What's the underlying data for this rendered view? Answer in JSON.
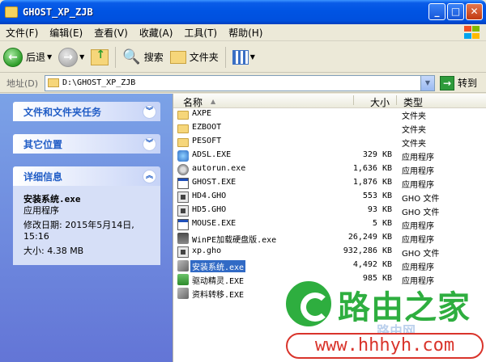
{
  "window": {
    "title": "GHOST_XP_ZJB"
  },
  "menu": [
    "文件(F)",
    "编辑(E)",
    "查看(V)",
    "收藏(A)",
    "工具(T)",
    "帮助(H)"
  ],
  "toolbar": {
    "back": "后退",
    "search": "搜索",
    "folders": "文件夹"
  },
  "address": {
    "label": "地址(D)",
    "path": "D:\\GHOST_XP_ZJB",
    "go": "转到"
  },
  "left": {
    "tasks_title": "文件和文件夹任务",
    "other_title": "其它位置",
    "details_title": "详细信息",
    "details": {
      "name": "安装系统.exe",
      "type": "应用程序",
      "modified": "修改日期: 2015年5月14日, 15:16",
      "size": "大小: 4.38 MB"
    }
  },
  "columns": {
    "name": "名称",
    "size": "大小",
    "type": "类型"
  },
  "files": [
    {
      "name": "AXPE",
      "size": "",
      "type": "文件夹",
      "icon": "folder"
    },
    {
      "name": "EZBOOT",
      "size": "",
      "type": "文件夹",
      "icon": "folder"
    },
    {
      "name": "PESOFT",
      "size": "",
      "type": "文件夹",
      "icon": "folder"
    },
    {
      "name": "ADSL.EXE",
      "size": "329 KB",
      "type": "应用程序",
      "icon": "app"
    },
    {
      "name": "autorun.exe",
      "size": "1,636 KB",
      "type": "应用程序",
      "icon": "gear"
    },
    {
      "name": "GHOST.EXE",
      "size": "1,876 KB",
      "type": "应用程序",
      "icon": "exe"
    },
    {
      "name": "HD4.GHO",
      "size": "553 KB",
      "type": "GHO 文件",
      "icon": "gho"
    },
    {
      "name": "HD5.GHO",
      "size": "93 KB",
      "type": "GHO 文件",
      "icon": "gho"
    },
    {
      "name": "MOUSE.EXE",
      "size": "5 KB",
      "type": "应用程序",
      "icon": "exe"
    },
    {
      "name": "WinPE加载硬盘版.exe",
      "size": "26,249 KB",
      "type": "应用程序",
      "icon": "wpe"
    },
    {
      "name": "xp.gho",
      "size": "932,286 KB",
      "type": "GHO 文件",
      "icon": "gho"
    },
    {
      "name": "安装系统.exe",
      "size": "4,492 KB",
      "type": "应用程序",
      "icon": "disk",
      "selected": true
    },
    {
      "name": "驱动精灵.EXE",
      "size": "985 KB",
      "type": "应用程序",
      "icon": "green"
    },
    {
      "name": "资料转移.EXE",
      "size": "",
      "type": "",
      "icon": "disk"
    }
  ],
  "watermark": {
    "title": "路由之家",
    "sub": "路由网",
    "url": "www.hhhyh.com"
  }
}
